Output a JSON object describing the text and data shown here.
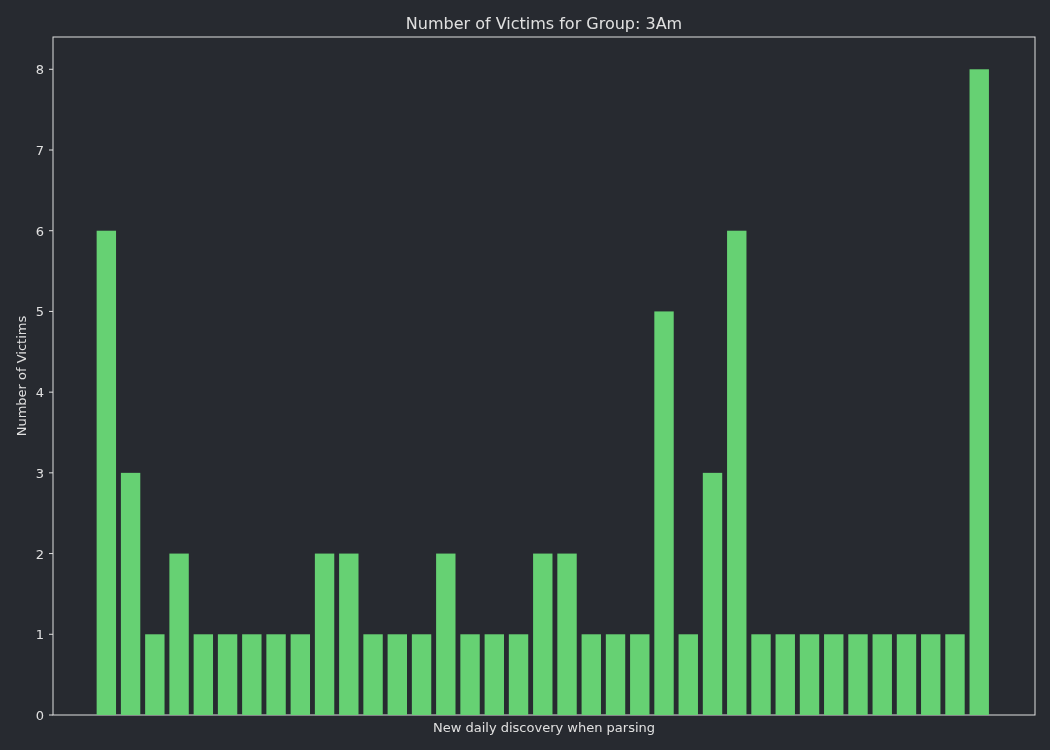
{
  "chart_data": {
    "type": "bar",
    "title": "Number of Victims for Group: 3Am",
    "xlabel": "New daily discovery when parsing",
    "ylabel": "Number of Victims",
    "series": [
      {
        "color": "#66d173",
        "values": [
          6,
          3,
          1,
          2,
          1,
          1,
          1,
          1,
          1,
          2,
          2,
          1,
          1,
          1,
          2,
          1,
          1,
          1,
          2,
          2,
          1,
          1,
          1,
          5,
          1,
          3,
          6,
          1,
          1,
          1,
          1,
          1,
          1,
          1,
          1,
          1,
          8
        ]
      }
    ],
    "ylim": [
      0,
      8.4
    ],
    "yticks": [
      0,
      1,
      2,
      3,
      4,
      5,
      6,
      7,
      8
    ]
  }
}
